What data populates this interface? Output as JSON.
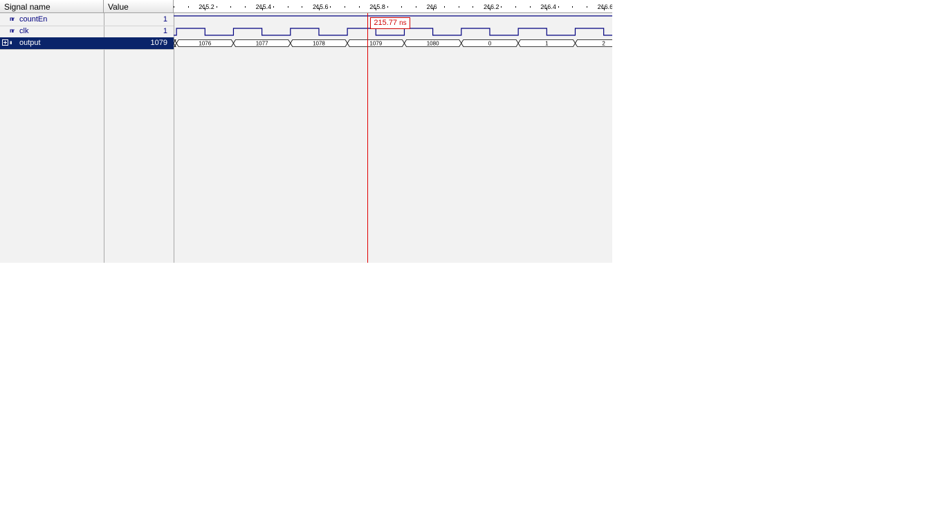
{
  "headers": {
    "signal_name": "Signal name",
    "value": "Value"
  },
  "signals": [
    {
      "name": "countEn",
      "value": "1",
      "icon": "signal-bit-icon",
      "icon_glyph": "ᴨr",
      "selected": false
    },
    {
      "name": "clk",
      "value": "1",
      "icon": "signal-bit-icon",
      "icon_glyph": "ᴨr",
      "selected": false
    },
    {
      "name": "output",
      "value": "1079",
      "icon": "signal-bus-icon",
      "icon_glyph": "ıı",
      "selected": true,
      "expandable": true
    }
  ],
  "ruler": {
    "labels": [
      "215.2",
      "215.4",
      "215.6",
      "215.8",
      "216",
      "216.2",
      "216.4",
      "216.6"
    ],
    "start": 215.09,
    "end": 216.63
  },
  "waveform": {
    "clk_period": 0.2,
    "clk_first_rise": 215.1,
    "output_bus": [
      {
        "value": "",
        "from": 215.09,
        "to": 215.1
      },
      {
        "value": "1076",
        "from": 215.1,
        "to": 215.3
      },
      {
        "value": "1077",
        "from": 215.3,
        "to": 215.5
      },
      {
        "value": "1078",
        "from": 215.5,
        "to": 215.7
      },
      {
        "value": "1079",
        "from": 215.7,
        "to": 215.9
      },
      {
        "value": "1080",
        "from": 215.9,
        "to": 216.1
      },
      {
        "value": "0",
        "from": 216.1,
        "to": 216.3
      },
      {
        "value": "1",
        "from": 216.3,
        "to": 216.5
      },
      {
        "value": "2",
        "from": 216.5,
        "to": 216.7
      }
    ]
  },
  "cursor": {
    "time": 215.77,
    "label": "215.77",
    "unit": "ns"
  },
  "colors": {
    "wave": "#00007f",
    "cursor": "#e00000",
    "selection": "#0a246a"
  }
}
